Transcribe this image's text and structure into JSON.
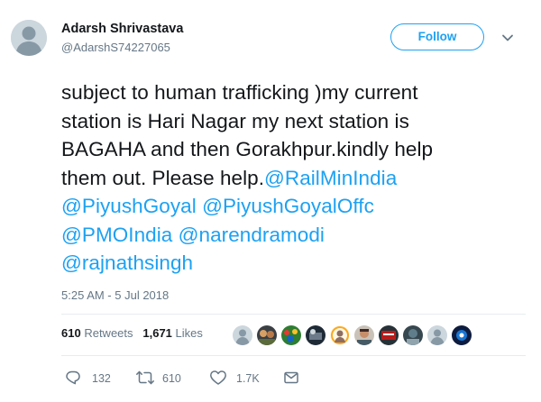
{
  "user": {
    "display_name": "Adarsh Shrivastava",
    "handle": "@AdarshS74227065"
  },
  "follow_label": "Follow",
  "tweet": {
    "line1": "subject to human trafficking )my current",
    "line2": "station is Hari Nagar my next station is",
    "line3": "BAGAHA and then Gorakhpur.kindly help",
    "line4_text": "them out. Please help.",
    "mentions": [
      "@RailMinIndia",
      "@PiyushGoyal",
      "@PiyushGoyalOffc",
      "@PMOIndia",
      "@narendramodi",
      "@rajnathsingh"
    ]
  },
  "timestamp": "5:25 AM - 5 Jul 2018",
  "stats": {
    "retweets_count": "610",
    "retweets_label": "Retweets",
    "likes_count": "1,671",
    "likes_label": "Likes"
  },
  "actions": {
    "reply_count": "132",
    "retweet_count": "610",
    "like_count": "1.7K"
  },
  "colors": {
    "accent": "#1da1f2",
    "secondary_text": "#657786",
    "primary_text": "#14171a",
    "divider": "#e6ecf0",
    "default_avatar": "#ccd6dd"
  },
  "icons": [
    "default-avatar-icon",
    "chevron-down-icon",
    "reply-icon",
    "retweet-icon",
    "heart-icon",
    "envelope-icon"
  ]
}
